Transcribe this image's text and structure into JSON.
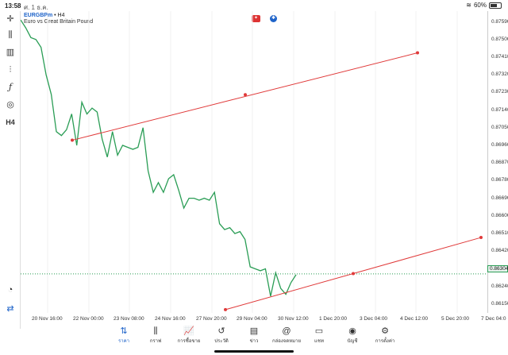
{
  "status_bar": {
    "time": "13:58",
    "date": "ศ. 1 ธ.ค.",
    "wifi_icon": "wifi-icon",
    "battery": "60%"
  },
  "symbol": {
    "name": "EURGBPm",
    "separator": "•",
    "timeframe": "H4",
    "description": "Euro vs Great Britain Pound"
  },
  "toolbar": {
    "timeframe_label": "H4"
  },
  "price_axis": {
    "labels": [
      "0.87590",
      "0.87500",
      "0.87410",
      "0.87320",
      "0.87230",
      "0.87140",
      "0.87050",
      "0.86960",
      "0.86870",
      "0.86780",
      "0.86690",
      "0.86600",
      "0.86510",
      "0.86420",
      "0.86330",
      "0.86240",
      "0.86150"
    ],
    "current_price": "0.86304"
  },
  "time_axis": [
    "20 Nov 16:00",
    "22 Nov 00:00",
    "23 Nov 08:00",
    "24 Nov 16:00",
    "27 Nov 20:00",
    "29 Nov 04:00",
    "30 Nov 12:00",
    "1 Dec 20:00",
    "3 Dec 04:00",
    "4 Dec 12:00",
    "5 Dec 20:00",
    "7 Dec 04:0"
  ],
  "bottom_nav": [
    {
      "label": "ราคา",
      "icon": "quotes-icon",
      "active": true
    },
    {
      "label": "กราฟ",
      "icon": "chart-icon",
      "active": false
    },
    {
      "label": "การซื้อขาย",
      "icon": "trade-icon",
      "active": false
    },
    {
      "label": "ประวัติ",
      "icon": "history-icon",
      "active": false
    },
    {
      "label": "ข่าว",
      "icon": "news-icon",
      "active": false
    },
    {
      "label": "กล่องจดหมาย",
      "icon": "mailbox-icon",
      "active": false
    },
    {
      "label": "แชท",
      "icon": "chat-icon",
      "active": false
    },
    {
      "label": "บัญชี",
      "icon": "account-icon",
      "active": false
    },
    {
      "label": "การตั้งค่า",
      "icon": "settings-icon",
      "active": false
    }
  ],
  "chart_data": {
    "type": "line",
    "series": [
      {
        "color": "#2a9d55",
        "values": [
          0.876,
          0.8756,
          0.8751,
          0.875,
          0.8746,
          0.8732,
          0.8722,
          0.8703,
          0.8701,
          0.8704,
          0.8712,
          0.8696,
          0.8718,
          0.8712,
          0.8715,
          0.8713,
          0.8699,
          0.869,
          0.8703,
          0.8691,
          0.8696,
          0.8695,
          0.8694,
          0.8695,
          0.8705,
          0.8683,
          0.8672,
          0.8677,
          0.8672,
          0.8679,
          0.8681,
          0.8673,
          0.8664,
          0.8669,
          0.8669,
          0.8668,
          0.8669,
          0.8668,
          0.8672,
          0.8656,
          0.8653,
          0.8654,
          0.8651,
          0.8652,
          0.8648,
          0.8634,
          0.8633,
          0.8632,
          0.8633,
          0.8619,
          0.8631,
          0.8623,
          0.862,
          0.8626,
          0.863
        ]
      }
    ],
    "trendlines": [
      {
        "color": "#e03a3a",
        "points": [
          [
            0.869862
          ],
          [
            0.872186
          ],
          [
            0.874321
          ]
        ]
      },
      {
        "color": "#e03a3a",
        "points": [
          [
            0.861216
          ],
          [
            0.863057
          ],
          [
            0.864898
          ]
        ]
      }
    ],
    "current_price_line": 0.86304,
    "ylim": [
      0.861,
      0.8763
    ]
  }
}
